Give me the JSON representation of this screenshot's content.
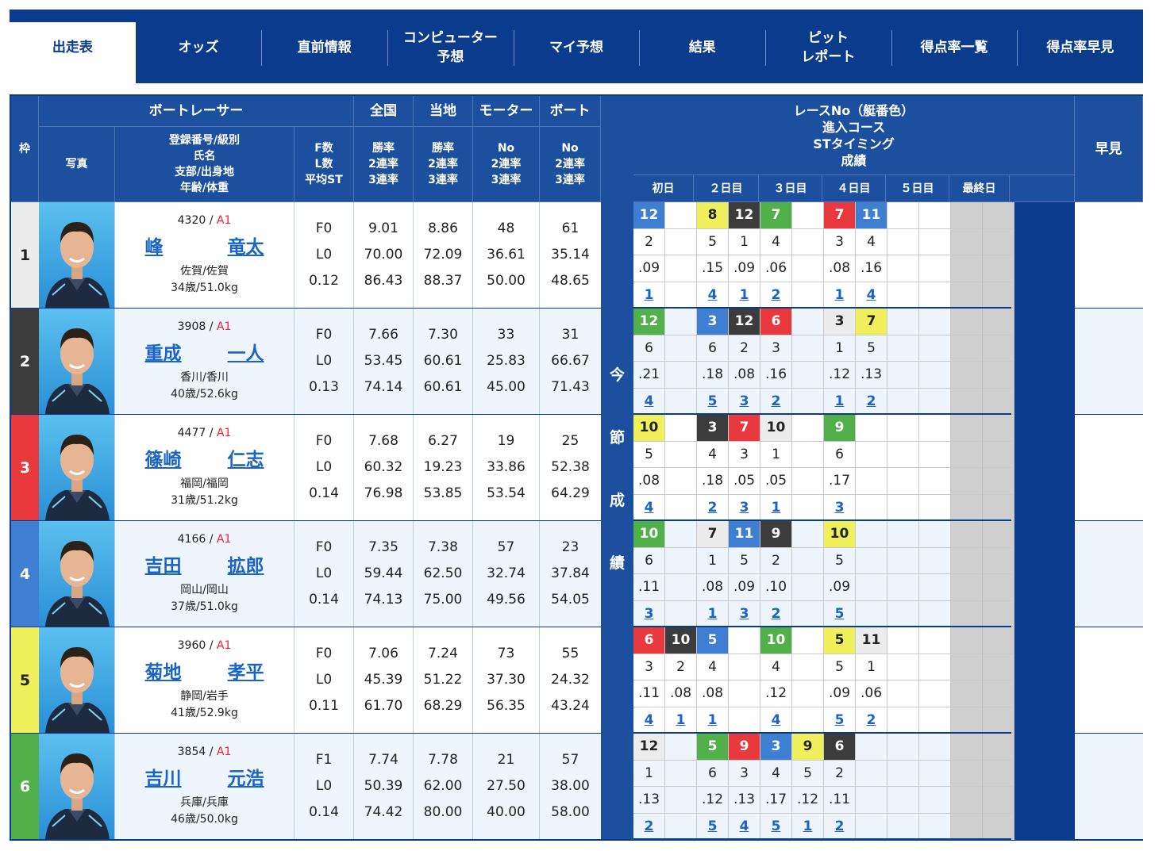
{
  "tabs": [
    {
      "label": "出走表",
      "active": true
    },
    {
      "label": "オッズ"
    },
    {
      "label": "直前情報"
    },
    {
      "label": "コンピューター\n予想"
    },
    {
      "label": "マイ予想"
    },
    {
      "label": "結果"
    },
    {
      "label": "ピット\nレポート"
    },
    {
      "label": "得点率一覧"
    },
    {
      "label": "得点率早見"
    }
  ],
  "header": {
    "waku": "枠",
    "boatracer": "ボートレーサー",
    "photo": "写真",
    "info": "登録番号/級別\n氏名\n支部/出身地\n年齢/体重",
    "fl": "F数\nL数\n平均ST",
    "zenkoku": "全国",
    "touchi": "当地",
    "motor": "モーター",
    "boat": "ボート",
    "rate": "勝率\n2連率\n3連率",
    "no": "No\n2連率\n3連率",
    "race": "レースNo（艇番色）\n進入コース\nSTタイミング\n成績",
    "hayami": "早見",
    "days": [
      "初日",
      "２日目",
      "３日目",
      "４日目",
      "５日目",
      "最終日"
    ],
    "konsetsu": [
      "今",
      "節",
      "成",
      "績"
    ]
  },
  "racers": [
    {
      "waku": "1",
      "reg": "4320",
      "cls": "A1",
      "name1": "峰",
      "name2": "竜太",
      "branch": "佐賀/佐賀",
      "age": "34歳/51.0kg",
      "f": "F0",
      "l": "L0",
      "st": "0.12",
      "zw": "9.01",
      "z2": "70.00",
      "z3": "86.43",
      "tw": "8.86",
      "t2": "72.09",
      "t3": "88.37",
      "mn": "48",
      "m2": "36.61",
      "m3": "50.00",
      "bn": "61",
      "b2": "35.14",
      "b3": "48.65"
    },
    {
      "waku": "2",
      "reg": "3908",
      "cls": "A1",
      "name1": "重成",
      "name2": "一人",
      "branch": "香川/香川",
      "age": "40歳/52.6kg",
      "f": "F0",
      "l": "L0",
      "st": "0.13",
      "zw": "7.66",
      "z2": "53.45",
      "z3": "74.14",
      "tw": "7.30",
      "t2": "60.61",
      "t3": "60.61",
      "mn": "33",
      "m2": "25.83",
      "m3": "45.00",
      "bn": "31",
      "b2": "66.67",
      "b3": "71.43"
    },
    {
      "waku": "3",
      "reg": "4477",
      "cls": "A1",
      "name1": "篠崎",
      "name2": "仁志",
      "branch": "福岡/福岡",
      "age": "31歳/51.2kg",
      "f": "F0",
      "l": "L0",
      "st": "0.14",
      "zw": "7.68",
      "z2": "60.32",
      "z3": "76.98",
      "tw": "6.27",
      "t2": "19.23",
      "t3": "53.85",
      "mn": "19",
      "m2": "33.86",
      "m3": "53.54",
      "bn": "25",
      "b2": "52.38",
      "b3": "64.29"
    },
    {
      "waku": "4",
      "reg": "4166",
      "cls": "A1",
      "name1": "吉田",
      "name2": "拡郎",
      "branch": "岡山/岡山",
      "age": "37歳/51.0kg",
      "f": "F0",
      "l": "L0",
      "st": "0.14",
      "zw": "7.35",
      "z2": "59.44",
      "z3": "74.13",
      "tw": "7.38",
      "t2": "62.50",
      "t3": "75.00",
      "mn": "57",
      "m2": "32.74",
      "m3": "49.56",
      "bn": "23",
      "b2": "37.84",
      "b3": "54.05"
    },
    {
      "waku": "5",
      "reg": "3960",
      "cls": "A1",
      "name1": "菊地",
      "name2": "孝平",
      "branch": "静岡/岩手",
      "age": "41歳/52.9kg",
      "f": "F0",
      "l": "L0",
      "st": "0.11",
      "zw": "7.06",
      "z2": "45.39",
      "z3": "61.70",
      "tw": "7.24",
      "t2": "51.22",
      "t3": "68.29",
      "mn": "73",
      "m2": "37.30",
      "m3": "56.35",
      "bn": "55",
      "b2": "24.32",
      "b3": "43.24"
    },
    {
      "waku": "6",
      "reg": "3854",
      "cls": "A1",
      "name1": "吉川",
      "name2": "元浩",
      "branch": "兵庫/兵庫",
      "age": "46歳/50.0kg",
      "f": "F1",
      "l": "L0",
      "st": "0.14",
      "zw": "7.74",
      "z2": "50.39",
      "z3": "74.42",
      "tw": "7.78",
      "t2": "62.00",
      "t3": "80.00",
      "mn": "21",
      "m2": "27.50",
      "m3": "40.00",
      "bn": "57",
      "b2": "38.00",
      "b3": "58.00"
    }
  ],
  "results": [
    [
      {
        "c": 0,
        "rn": "12",
        "t": 4,
        "co": "2",
        "st": ".09",
        "rk": "1"
      },
      {
        "c": 2,
        "rn": "8",
        "t": 5,
        "co": "5",
        "st": ".15",
        "rk": "4"
      },
      {
        "c": 3,
        "rn": "12",
        "t": 2,
        "co": "1",
        "st": ".09",
        "rk": "1"
      },
      {
        "c": 4,
        "rn": "7",
        "t": 6,
        "co": "4",
        "st": ".06",
        "rk": "2"
      },
      {
        "c": 6,
        "rn": "7",
        "t": 3,
        "co": "3",
        "st": ".08",
        "rk": "1"
      },
      {
        "c": 7,
        "rn": "11",
        "t": 4,
        "co": "4",
        "st": ".16",
        "rk": "4"
      }
    ],
    [
      {
        "c": 0,
        "rn": "12",
        "t": 6,
        "co": "6",
        "st": ".21",
        "rk": "4"
      },
      {
        "c": 2,
        "rn": "3",
        "t": 4,
        "co": "6",
        "st": ".18",
        "rk": "5"
      },
      {
        "c": 3,
        "rn": "12",
        "t": 2,
        "co": "2",
        "st": ".08",
        "rk": "3"
      },
      {
        "c": 4,
        "rn": "6",
        "t": 3,
        "co": "3",
        "st": ".16",
        "rk": "2"
      },
      {
        "c": 6,
        "rn": "3",
        "t": 1,
        "co": "1",
        "st": ".12",
        "rk": "1"
      },
      {
        "c": 7,
        "rn": "7",
        "t": 5,
        "co": "5",
        "st": ".13",
        "rk": "2"
      }
    ],
    [
      {
        "c": 0,
        "rn": "10",
        "t": 5,
        "co": "5",
        "st": ".08",
        "rk": "4"
      },
      {
        "c": 2,
        "rn": "3",
        "t": 2,
        "co": "4",
        "st": ".18",
        "rk": "2"
      },
      {
        "c": 3,
        "rn": "7",
        "t": 3,
        "co": "3",
        "st": ".05",
        "rk": "3"
      },
      {
        "c": 4,
        "rn": "10",
        "t": 1,
        "co": "1",
        "st": ".05",
        "rk": "1"
      },
      {
        "c": 6,
        "rn": "9",
        "t": 6,
        "co": "6",
        "st": ".17",
        "rk": "3"
      }
    ],
    [
      {
        "c": 0,
        "rn": "10",
        "t": 6,
        "co": "6",
        "st": ".11",
        "rk": "3"
      },
      {
        "c": 2,
        "rn": "7",
        "t": 1,
        "co": "1",
        "st": ".08",
        "rk": "1"
      },
      {
        "c": 3,
        "rn": "11",
        "t": 4,
        "co": "5",
        "st": ".09",
        "rk": "3"
      },
      {
        "c": 4,
        "rn": "9",
        "t": 2,
        "co": "2",
        "st": ".10",
        "rk": "2"
      },
      {
        "c": 6,
        "rn": "10",
        "t": 5,
        "co": "5",
        "st": ".09",
        "rk": "5"
      }
    ],
    [
      {
        "c": 0,
        "rn": "6",
        "t": 3,
        "co": "3",
        "st": ".11",
        "rk": "4"
      },
      {
        "c": 1,
        "rn": "10",
        "t": 2,
        "co": "2",
        "st": ".08",
        "rk": "1"
      },
      {
        "c": 2,
        "rn": "5",
        "t": 4,
        "co": "4",
        "st": ".08",
        "rk": "1"
      },
      {
        "c": 4,
        "rn": "10",
        "t": 6,
        "co": "4",
        "st": ".12",
        "rk": "4"
      },
      {
        "c": 6,
        "rn": "5",
        "t": 5,
        "co": "5",
        "st": ".09",
        "rk": "5"
      },
      {
        "c": 7,
        "rn": "11",
        "t": 1,
        "co": "1",
        "st": ".06",
        "rk": "2"
      }
    ],
    [
      {
        "c": 0,
        "rn": "12",
        "t": 1,
        "co": "1",
        "st": ".13",
        "rk": "2"
      },
      {
        "c": 2,
        "rn": "5",
        "t": 6,
        "co": "6",
        "st": ".12",
        "rk": "5"
      },
      {
        "c": 3,
        "rn": "9",
        "t": 3,
        "co": "3",
        "st": ".13",
        "rk": "4"
      },
      {
        "c": 4,
        "rn": "3",
        "t": 4,
        "co": "4",
        "st": ".17",
        "rk": "5"
      },
      {
        "c": 5,
        "rn": "9",
        "t": 5,
        "co": "5",
        "st": ".12",
        "rk": "1"
      },
      {
        "c": 6,
        "rn": "6",
        "t": 2,
        "co": "2",
        "st": ".11",
        "rk": "2"
      }
    ]
  ],
  "colors": {
    "1": "#ffffff",
    "2": "#3c3c3c",
    "3": "#e8393f",
    "4": "#3f7fd1",
    "5": "#f0ef5c",
    "6": "#52b04a",
    "waku_bg": {
      "1": "#ececec",
      "2": "#3c3c3c",
      "3": "#e8393f",
      "4": "#3f7fd1",
      "5": "#f0ef5c",
      "6": "#52b04a"
    }
  }
}
